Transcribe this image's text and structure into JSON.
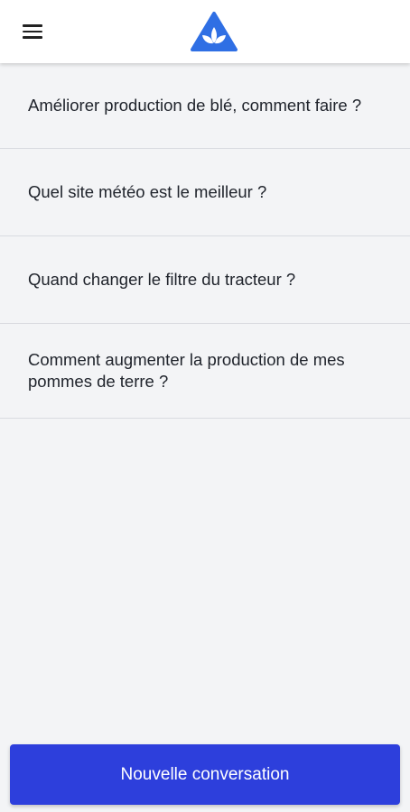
{
  "header": {
    "menu_icon": "hamburger-menu-icon",
    "logo_icon": "leaf-triangle-logo-icon",
    "colors": {
      "logo_primary": "#2f6fe4",
      "logo_secondary": "#5b95f5"
    }
  },
  "conversations": [
    {
      "label": "Améliorer production de blé, comment faire ?"
    },
    {
      "label": "Quel site météo est le meilleur ?"
    },
    {
      "label": "Quand changer le filtre du tracteur ?"
    },
    {
      "label": "Comment augmenter la production de mes pommes de terre ?"
    }
  ],
  "cta": {
    "label": "Nouvelle conversation",
    "color": "#2d3fdc"
  }
}
